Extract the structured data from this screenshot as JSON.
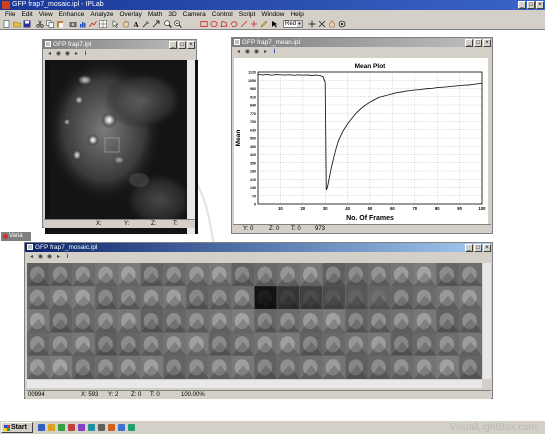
{
  "app": {
    "title": "GFP frap7_mosaic.ipl - IPLab"
  },
  "menubar": [
    "File",
    "Edit",
    "View",
    "Enhance",
    "Analyze",
    "Overlay",
    "Math",
    "3D",
    "Camera",
    "Control",
    "Script",
    "Window",
    "Help"
  ],
  "toolbar": {
    "color_value": "Red"
  },
  "image_window": {
    "title": "GFP frap7.ipl",
    "tool_info": "i",
    "status": {
      "x": "X:",
      "y": "Y:",
      "z": "Z:",
      "t": "T:"
    }
  },
  "plot_window": {
    "title": "GFP frap7_mean.ipl",
    "tool_info": "i",
    "status": {
      "y": "Y: 0",
      "z": "Z: 0",
      "t": "T: 0",
      "value": "973"
    }
  },
  "mosaic_window": {
    "title": "GFP frap7_mosaic.ipl",
    "tool_info": "i",
    "status": {
      "value": "00994",
      "x": "X: 593",
      "y": "Y: 2",
      "z": "Z: 0",
      "t": "T: 0",
      "zoom": "100.00%"
    }
  },
  "variable_tab": {
    "label": "Varia"
  },
  "taskbar": {
    "start_label": "Start"
  },
  "watermark": "VisualLightBox.com",
  "chart_data": {
    "type": "line",
    "title": "Mean Plot",
    "xlabel": "No. Of Frames",
    "ylabel": "Mean",
    "xlim": [
      0,
      100
    ],
    "ylim": [
      0,
      1120
    ],
    "x_ticks": [
      10,
      20,
      30,
      40,
      50,
      60,
      70,
      80,
      90,
      100
    ],
    "y_ticks": [
      0,
      70,
      140,
      210,
      280,
      350,
      420,
      490,
      560,
      630,
      700,
      770,
      840,
      910,
      980,
      1050,
      1120
    ],
    "grid": true,
    "series": [
      {
        "x": [
          0,
          2,
          4,
          6,
          8,
          10,
          12,
          14,
          16,
          18,
          20,
          22,
          24,
          26,
          28,
          29,
          30,
          30.5,
          31,
          32,
          33,
          34,
          35,
          36,
          38,
          40,
          42,
          44,
          46,
          48,
          50,
          52,
          54,
          56,
          58,
          60,
          62,
          64,
          66,
          68,
          70,
          72,
          74,
          76,
          78,
          80,
          82,
          84,
          86,
          88,
          90,
          92,
          94,
          96,
          98,
          100
        ],
        "y": [
          1100,
          1095,
          1100,
          1093,
          1098,
          1096,
          1094,
          1097,
          1092,
          1096,
          1093,
          1095,
          1090,
          1094,
          1088,
          1080,
          1030,
          120,
          140,
          240,
          330,
          410,
          480,
          540,
          620,
          680,
          730,
          775,
          810,
          840,
          865,
          885,
          905,
          915,
          925,
          935,
          945,
          950,
          958,
          962,
          968,
          970,
          975,
          980,
          982,
          988,
          990,
          994,
          998,
          1000,
          1005,
          1008,
          1010,
          1015,
          1020,
          1025
        ]
      }
    ]
  }
}
